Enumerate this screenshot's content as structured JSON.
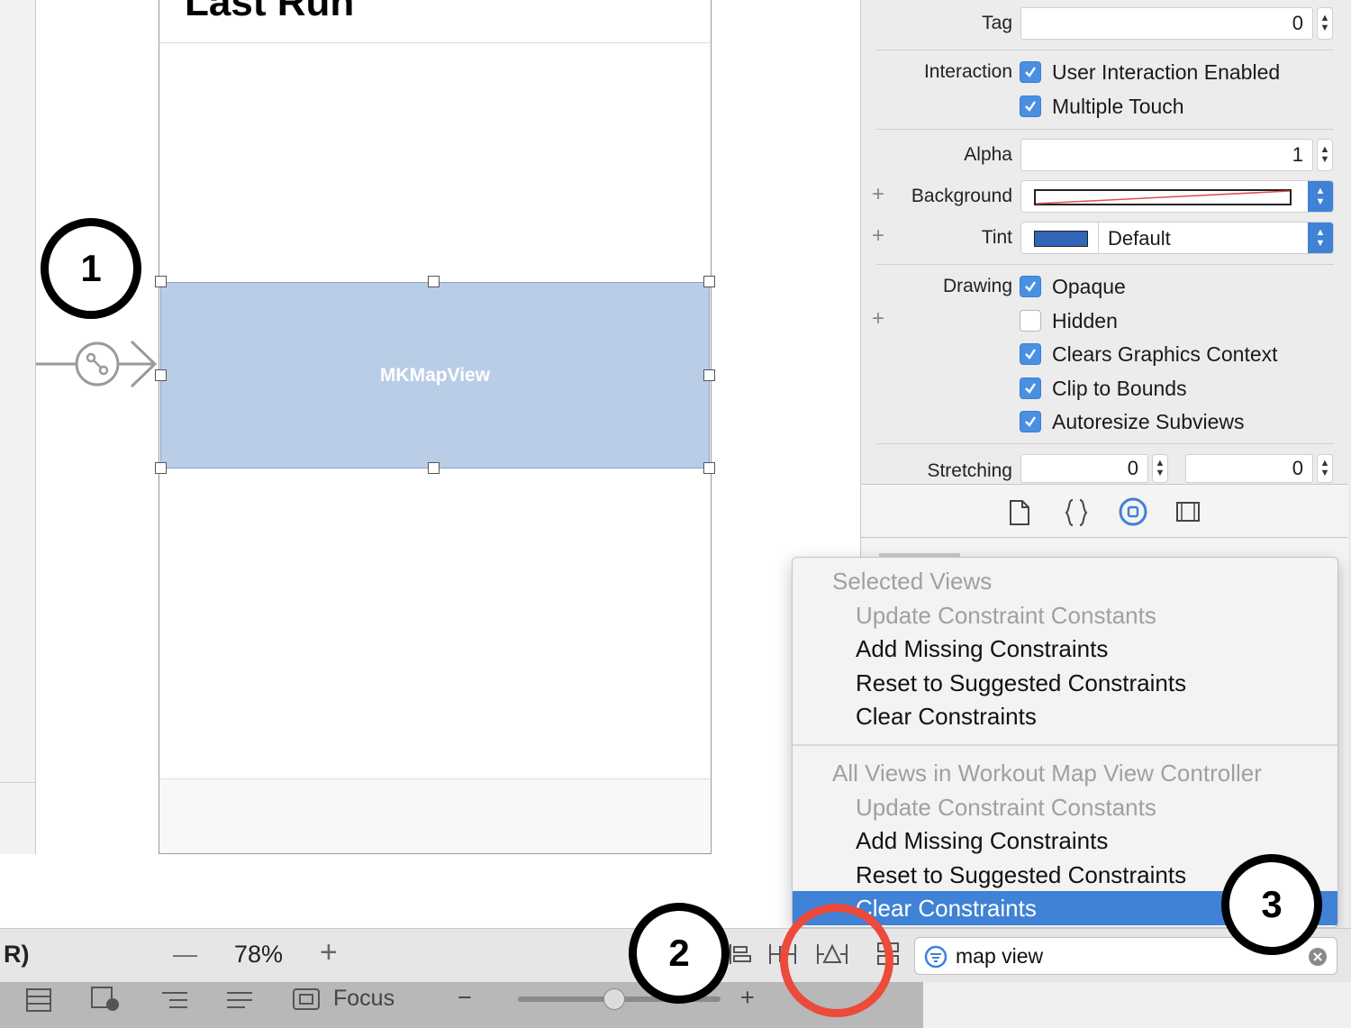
{
  "scene": {
    "title": "Last Run",
    "mapview_label": "MKMapView"
  },
  "callouts": [
    "1",
    "2",
    "3"
  ],
  "inspector": {
    "tag_label": "Tag",
    "tag_value": "0",
    "interaction_label": "Interaction",
    "user_interaction": "User Interaction Enabled",
    "multiple_touch": "Multiple Touch",
    "alpha_label": "Alpha",
    "alpha_value": "1",
    "background_label": "Background",
    "tint_label": "Tint",
    "tint_value": "Default",
    "tint_color": "#3264b8",
    "drawing_label": "Drawing",
    "opaque": "Opaque",
    "hidden": "Hidden",
    "clears_graphics": "Clears Graphics Context",
    "clip_to_bounds": "Clip to Bounds",
    "autoresize": "Autoresize Subviews",
    "stretching_label": "Stretching",
    "stretch_x": "0",
    "stretch_y": "0"
  },
  "menu": {
    "section1_header": "Selected Views",
    "section1_items": [
      "Update Constraint Constants",
      "Add Missing Constraints",
      "Reset to Suggested Constraints",
      "Clear Constraints"
    ],
    "section2_header": "All Views in Workout Map View Controller",
    "section2_items": [
      "Update Constraint Constants",
      "Add Missing Constraints",
      "Reset to Suggested Constraints",
      "Clear Constraints"
    ]
  },
  "bottom_bar": {
    "left_fragment": "R)",
    "zoom_minus": "—",
    "zoom_value": "78%",
    "zoom_plus": "+",
    "search_value": "map view"
  },
  "status_bar": {
    "focus_label": "Focus",
    "minus": "−",
    "plus": "+"
  },
  "colors": {
    "accent": "#3f82d6",
    "highlight_ring": "#ec4a3a",
    "mapview_fill": "#bacde6"
  }
}
